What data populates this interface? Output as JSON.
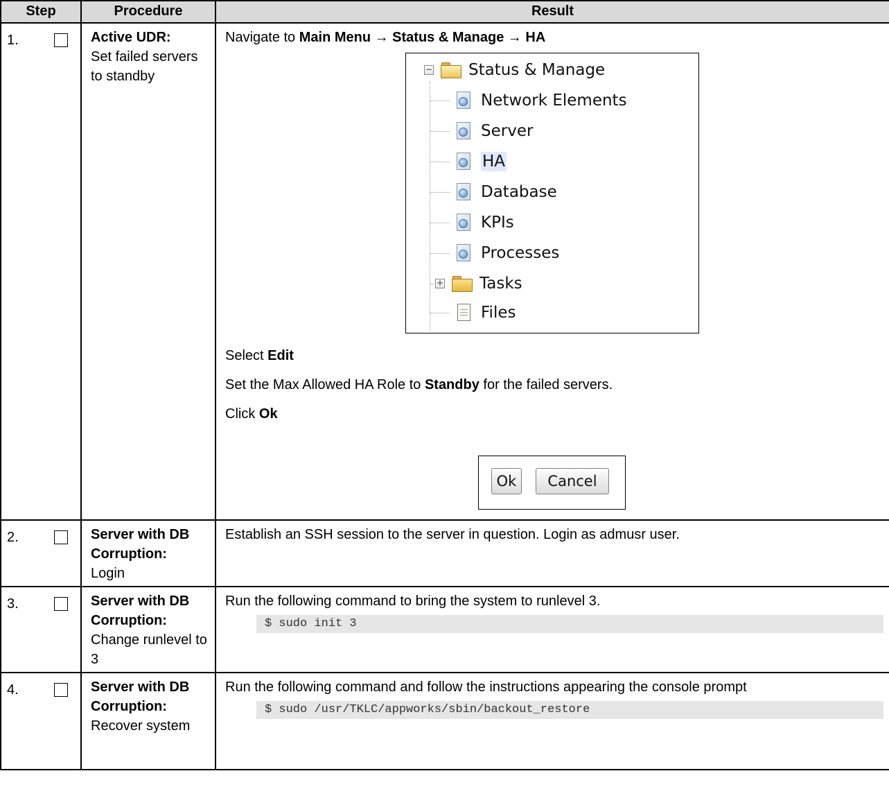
{
  "headers": {
    "step": "Step",
    "procedure": "Procedure",
    "result": "Result"
  },
  "rows": [
    {
      "num": "1.",
      "proc_bold": "Active UDR:",
      "proc_text": "Set failed servers to standby",
      "nav_prefix": "Navigate to ",
      "nav_path": "Main Menu → Status & Manage → HA",
      "tree": {
        "root": "Status & Manage",
        "items": [
          "Network Elements",
          "Server",
          "HA",
          "Database",
          "KPIs",
          "Processes"
        ],
        "tasks": "Tasks",
        "files": "Files",
        "expanded_symbol": "−",
        "collapsed_symbol": "+"
      },
      "select_prefix": "Select ",
      "select_bold": "Edit",
      "set_prefix": "Set the Max Allowed HA Role to ",
      "set_bold": "Standby",
      "set_suffix": " for the failed servers.",
      "click_prefix": "Click ",
      "click_bold": "Ok",
      "ok_button": "Ok",
      "cancel_button": "Cancel"
    },
    {
      "num": "2.",
      "proc_bold": "Server with DB Corruption:",
      "proc_text": "Login",
      "result": "Establish an SSH session to the server in question. Login as admusr user."
    },
    {
      "num": "3.",
      "proc_bold": "Server with DB Corruption:",
      "proc_text": "Change runlevel to 3",
      "result": "Run the following command to bring the system to runlevel 3.",
      "code": "$ sudo init 3"
    },
    {
      "num": "4.",
      "proc_bold": "Server with DB Corruption:",
      "proc_text": "Recover system",
      "result": "Run the following command and follow the instructions appearing the console prompt",
      "code": "$ sudo /usr/TKLC/appworks/sbin/backout_restore"
    }
  ]
}
